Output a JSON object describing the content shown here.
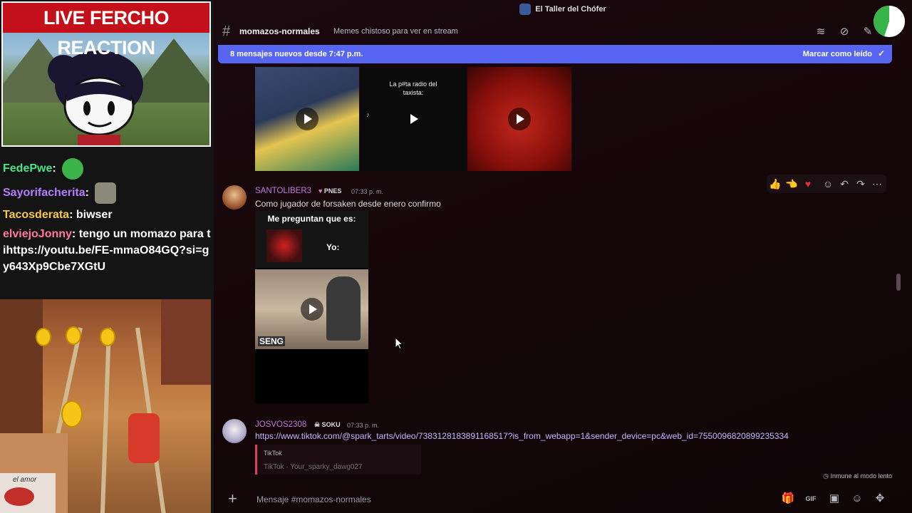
{
  "stream_overlay": {
    "banner_title": "LIVE FERCHO REACTION",
    "chat": [
      {
        "user": "FedePwe",
        "user_color": "#45e68a",
        "message": "",
        "emote": "green-pepe-emote"
      },
      {
        "user": "Sayorifacherita",
        "user_color": "#b57cff",
        "message": "",
        "emote": "cat-emote"
      },
      {
        "user": "Tacosderata",
        "user_color": "#f5c84a",
        "message": "biwser"
      },
      {
        "user": "elviejoJonny",
        "user_color": "#ff77a0",
        "message": "tengo un momazo para tihttps://youtu.be/FE-mmaO84GQ?si=gy643Xp9Cbe7XGtU"
      }
    ],
    "game_stamp": "el amor"
  },
  "discord": {
    "window_title": "El Taller del Chófer",
    "channel": {
      "name": "momazos-normales",
      "topic": "Memes chistoso para ver en stream"
    },
    "new_messages_banner": {
      "text": "8 mensajes nuevos desde 7:47 p.m.",
      "mark_read": "Marcar como leído"
    },
    "media_top": [
      {
        "caption": ""
      },
      {
        "caption": "La p#ta radio del taxista:"
      },
      {
        "caption": ""
      }
    ],
    "messages": [
      {
        "username": "SANTOLIBER3",
        "username_color": "#c07adf",
        "tag": "PNES",
        "timestamp": "07:33 p. m.",
        "text": "Como jugador de forsaken desde enero confirmo",
        "meme_top_text": "Me preguntan que es:",
        "meme_yo": "Yo:",
        "meme_bottom_text": "SENG"
      },
      {
        "username": "JOSVOS2308",
        "username_color": "#c07adf",
        "tag": "SOKU",
        "timestamp": "07:33 p. m.",
        "link": "https://www.tiktok.com/@spark_tarts/video/7383128183891168517?is_from_webapp=1&sender_device=pc&web_id=7550096820899235334",
        "embed_site": "TikTok",
        "embed_title": "TikTok · Your_sparky_dawg027"
      }
    ],
    "slowmode_text": "Inmune al modo lento",
    "composer_placeholder": "Mensaje #momazos-normales",
    "colors": {
      "accent": "#5865f2",
      "banner_text": "#ffffff"
    }
  }
}
